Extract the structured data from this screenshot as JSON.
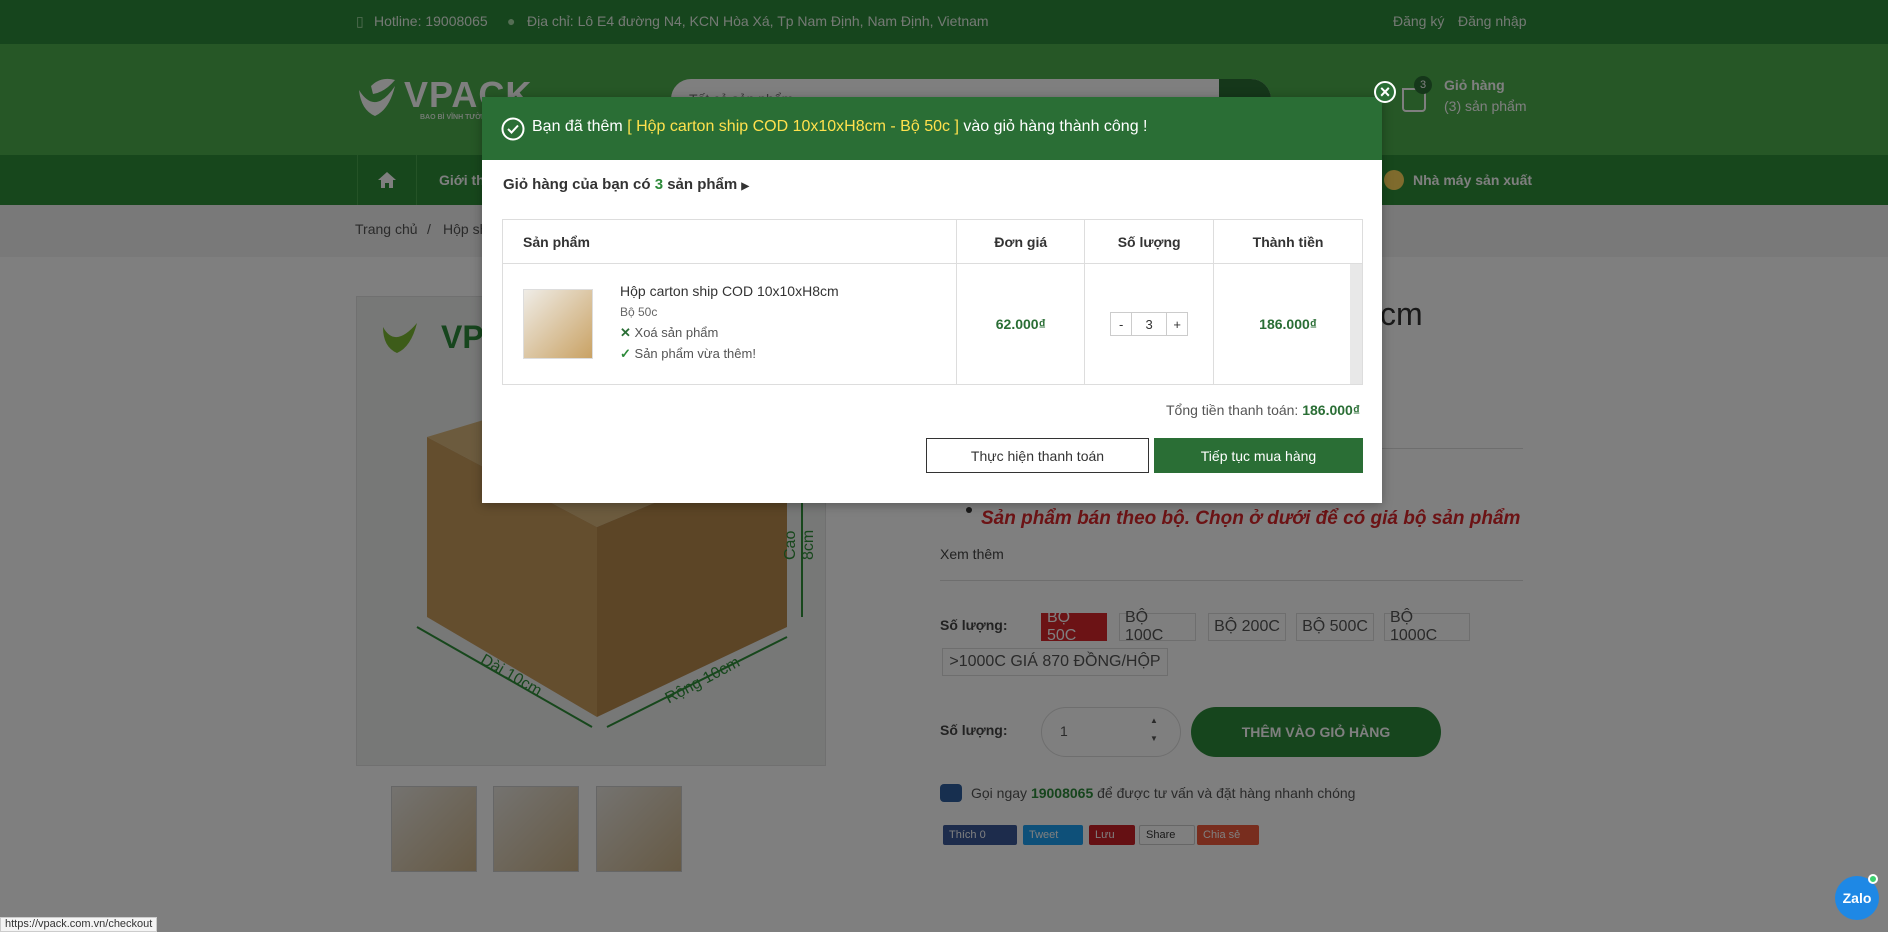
{
  "topbar": {
    "hotline": "Hotline: 19008065",
    "address": "Địa chỉ: Lô E4 đường N4, KCN Hòa Xá, Tp Nam Định, Nam Định, Vietnam",
    "register": "Đăng ký",
    "login": "Đăng nhập"
  },
  "header": {
    "logo_text": "VPACK",
    "logo_sub": "BAO BÌ VĨNH TƯỜNG",
    "search_placeholder": "Tất cả sản phẩm",
    "cart_count": "3",
    "cart_label": "Giỏ hàng",
    "cart_items": "(3) sản phẩm"
  },
  "nav": {
    "item1": "Giới thi",
    "factory": "Nhà máy sản xuất"
  },
  "breadcrumb": {
    "home": "Trang chủ",
    "sep": "/",
    "current": "Hộp sh"
  },
  "product": {
    "title_tail": "cm",
    "note": "Sản phẩm bán theo bộ. Chọn ở dưới để có giá bộ sản phẩm",
    "see_more": "Xem thêm",
    "qty_label_1": "Số lượng:",
    "options": [
      "BỘ 50C",
      "BỘ 100C",
      "BỘ 200C",
      "BỘ 500C",
      "BỘ 1000C",
      ">1000C GIÁ 870 ĐỒNG/HỘP"
    ],
    "qty_label_2": "Số lượng:",
    "qty_value": "1",
    "add_to_cart": "THÊM VÀO GIỎ HÀNG",
    "call_pre": "Gọi ngay",
    "call_number": "19008065",
    "call_post": "để được tư vấn và đặt hàng nhanh chóng",
    "image_texts": [
      "VPACK",
      "Dài 10cm",
      "Rộng 10cm",
      "Cao 8cm"
    ]
  },
  "share": {
    "fb": "Thích 0",
    "tw": "Tweet",
    "pin": "Lưu",
    "li": "Share",
    "more": "Chia sẻ"
  },
  "modal": {
    "added_pre": "Bạn đã thêm",
    "added_product": "[ Hộp carton ship COD 10x10xH8cm - Bộ 50c ]",
    "added_post": "vào giỏ hàng thành công !",
    "cart_summary_pre": "Giỏ hàng của bạn có",
    "cart_summary_count": "3",
    "cart_summary_post": "sản phẩm",
    "columns": [
      "Sản phẩm",
      "Đơn giá",
      "Số lượng",
      "Thành tiền"
    ],
    "item_name": "Hộp carton ship COD 10x10xH8cm",
    "item_variant": "Bộ 50c",
    "remove": "Xoá sản phẩm",
    "just_added": "Sản phẩm vừa thêm!",
    "unit_price": "62.000₫",
    "qty_minus": "-",
    "qty": "3",
    "qty_plus": "+",
    "line_total": "186.000₫",
    "total_label": "Tổng tiền thanh toán:",
    "total_value": "186.000₫",
    "checkout": "Thực hiện thanh toán",
    "continue": "Tiếp tục mua hàng",
    "close": "×"
  },
  "status_url": "https://vpack.com.vn/checkout",
  "zalo": "Zalo",
  "colors": {
    "green_dark": "#2a6e35",
    "green": "#4cae4c",
    "accent_yellow": "#ffe14d",
    "note_red": "#d9262b"
  }
}
